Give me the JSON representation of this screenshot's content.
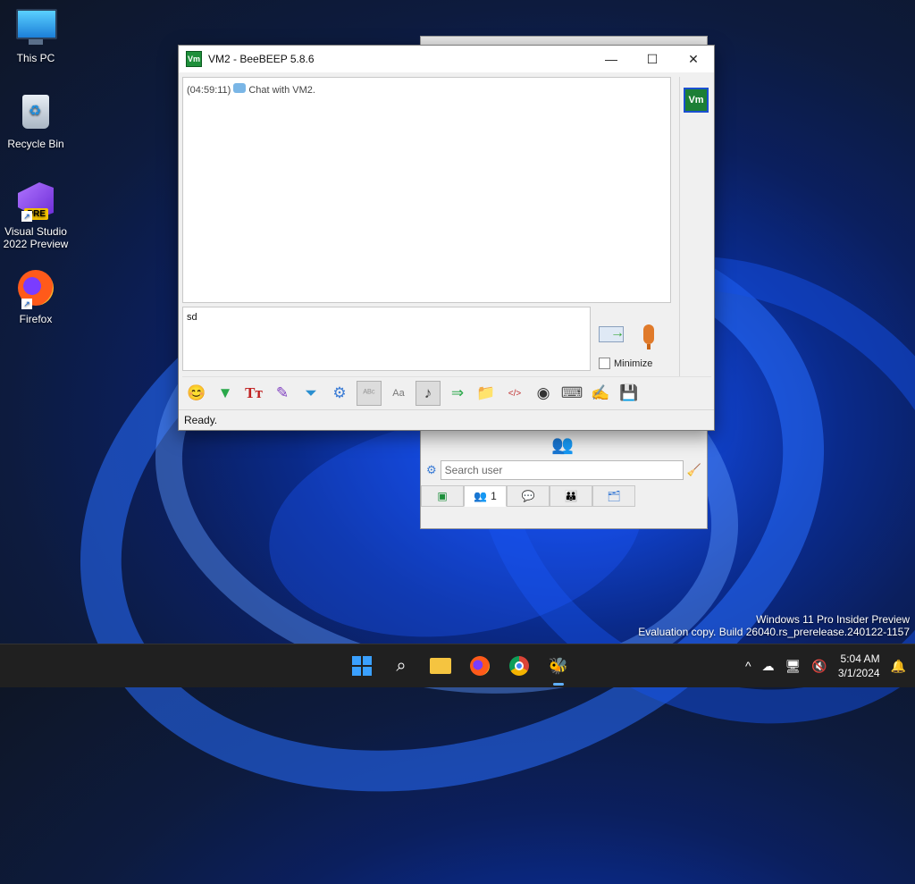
{
  "desktop": {
    "icons": [
      {
        "label": "This PC"
      },
      {
        "label": "Recycle Bin"
      },
      {
        "label": "Visual Studio 2022 Preview",
        "badge": "PRE"
      },
      {
        "label": "Firefox"
      }
    ]
  },
  "chat_window": {
    "app_icon_text": "Vm",
    "title": "VM2 - BeeBEEP 5.8.6",
    "buttons": {
      "minimize": "—",
      "maximize": "☐",
      "close": "✕"
    },
    "messages": [
      {
        "time": "(04:59:11)",
        "text": "Chat with VM2."
      }
    ],
    "side_badge": "Vm",
    "input_value": "sd",
    "minimize_label": "Minimize",
    "status": "Ready.",
    "toolbar": [
      {
        "icon": "smiley-icon",
        "glyph": "😊"
      },
      {
        "icon": "arrow-down-icon",
        "glyph": "▼"
      },
      {
        "icon": "font-icon",
        "glyph": "Tт"
      },
      {
        "icon": "color-picker-icon",
        "glyph": "✎"
      },
      {
        "icon": "filter-icon",
        "glyph": "⏷"
      },
      {
        "icon": "settings-icon",
        "glyph": "⚙"
      },
      {
        "icon": "spellcheck-icon",
        "glyph": "ᴬᴮᶜ"
      },
      {
        "icon": "dictionary-icon",
        "glyph": "Aa"
      },
      {
        "icon": "sound-icon",
        "glyph": "♪"
      },
      {
        "icon": "send-file-icon",
        "glyph": "⇒"
      },
      {
        "icon": "send-folder-icon",
        "glyph": "📁"
      },
      {
        "icon": "html-icon",
        "glyph": "</>"
      },
      {
        "icon": "screenshot-icon",
        "glyph": "◉"
      },
      {
        "icon": "keyboard-icon",
        "glyph": "⌨"
      },
      {
        "icon": "note-icon",
        "glyph": "✍"
      },
      {
        "icon": "save-icon",
        "glyph": "💾"
      }
    ]
  },
  "main_window": {
    "search_placeholder": "Search user",
    "tabs": [
      {
        "icon": "chip-icon",
        "label": ""
      },
      {
        "icon": "users-icon",
        "label": "1"
      },
      {
        "icon": "chats-icon",
        "label": ""
      },
      {
        "icon": "groups-icon",
        "label": ""
      },
      {
        "icon": "files-icon",
        "label": ""
      }
    ]
  },
  "watermark": {
    "line1": "Windows 11 Pro Insider Preview",
    "line2": "Evaluation copy. Build 26040.rs_prerelease.240122-1157"
  },
  "taskbar": {
    "time": "5:04 AM",
    "date": "3/1/2024"
  }
}
